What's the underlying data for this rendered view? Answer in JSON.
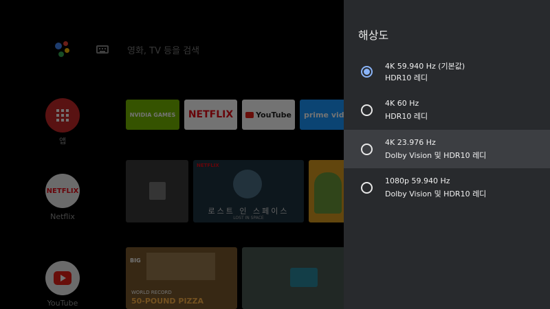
{
  "launcher": {
    "search_hint": "영화, TV 등을 검색",
    "side_apps": [
      {
        "label": "앱",
        "color": "#c62828"
      },
      {
        "label": "Netflix",
        "logo": "NETFLIX",
        "color": "#eeeeee"
      },
      {
        "label": "YouTube",
        "color": "#eeeeee"
      }
    ],
    "chips": {
      "nvidia": "NVIDIA GAMES",
      "netflix": "NETFLIX",
      "youtube": "YouTube",
      "prime": "prime video"
    },
    "tiles": {
      "netflix_badge": "NETFLIX",
      "lost_in_space_title": "로스트 인 스페이스",
      "lost_in_space_sub": "LOST IN SPACE",
      "big_badge": "BIG",
      "pizza_title_1": "WORLD RECORD",
      "pizza_title_2": "50-POUND PIZZA"
    }
  },
  "panel": {
    "title": "해상도",
    "accent_color": "#8ab4f8",
    "options": [
      {
        "title": "4K 59.940 Hz (기본값)",
        "subtitle": "HDR10 레디",
        "selected": true,
        "focused": false
      },
      {
        "title": "4K 60 Hz",
        "subtitle": "HDR10 레디",
        "selected": false,
        "focused": false
      },
      {
        "title": "4K 23.976 Hz",
        "subtitle": "Dolby Vision 및 HDR10 레디",
        "selected": false,
        "focused": true
      },
      {
        "title": "1080p 59.940 Hz",
        "subtitle": "Dolby Vision 및 HDR10 레디",
        "selected": false,
        "focused": false
      }
    ]
  }
}
